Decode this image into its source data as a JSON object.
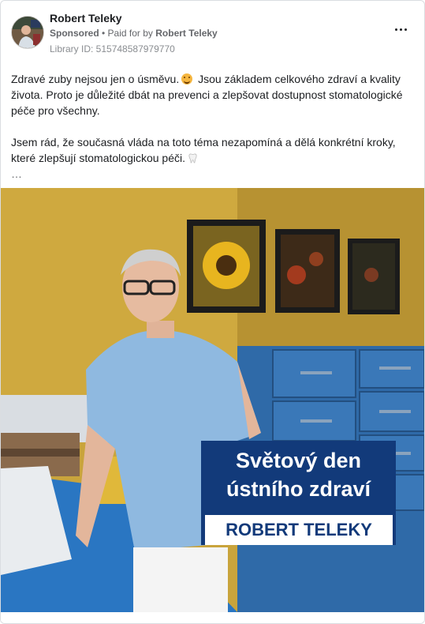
{
  "post": {
    "author": "Robert Teleky",
    "sponsored_label": "Sponsored",
    "paid_for_prefix": "• Paid for by",
    "paid_for_name": "Robert Teleky",
    "library_id": "Library ID: 515748587979770",
    "more_icon": "more-horizontal-icon",
    "text_p1_a": "Zdravé zuby nejsou jen o úsměvu.",
    "text_p1_b": "Jsou základem celkového zdraví a kvality života. Proto je důležité dbát na prevenci a zlepšovat dostupnost stomatologické péče pro všechny.",
    "text_p2": "Jsem rád, že současná vláda na toto téma nezapomíná a dělá konkrétní kroky, které zlepšují stomatologickou péči.",
    "see_more": "…"
  },
  "media": {
    "overlay_line1": "Světový den",
    "overlay_line2": "ústního zdraví",
    "overlay_name": "ROBERT TELEKY"
  },
  "colors": {
    "overlay_blue": "#123a7a",
    "wall_yellow": "#c9a43c",
    "scrubs_blue": "#8fb9e0",
    "cabinet_blue": "#2f6aa8"
  }
}
